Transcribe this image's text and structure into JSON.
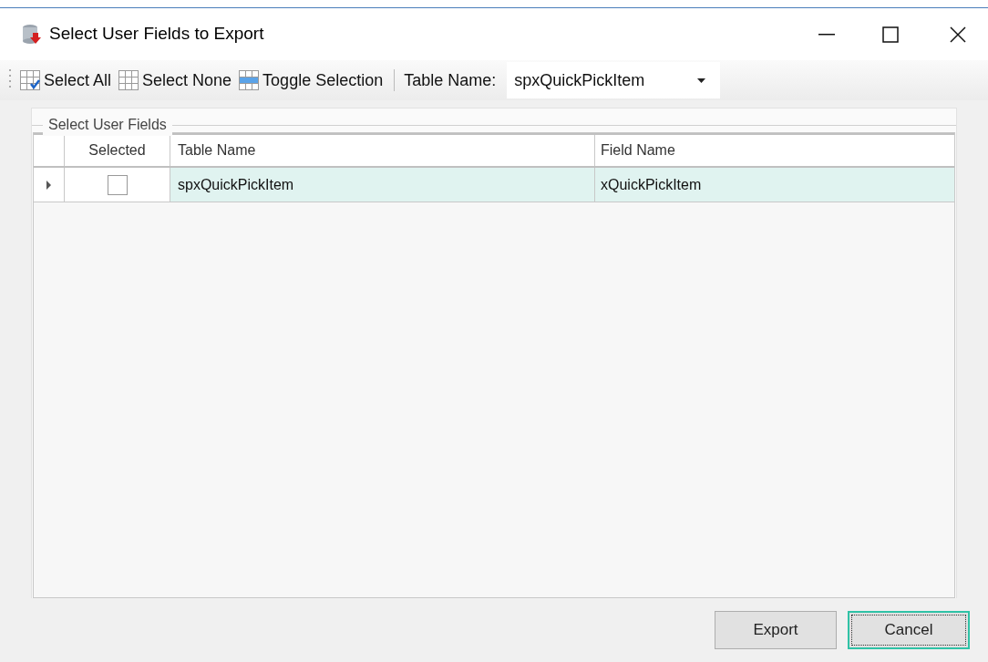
{
  "window": {
    "title": "Select User Fields to Export"
  },
  "toolbar": {
    "buttons": [
      {
        "kind": "all",
        "label": "Select All"
      },
      {
        "kind": "none",
        "label": "Select None"
      },
      {
        "kind": "toggle",
        "label": "Toggle Selection"
      }
    ],
    "table_name_label": "Table Name:",
    "table_name_value": "spxQuickPickItem"
  },
  "group": {
    "title": "Select User Fields"
  },
  "table": {
    "columns": [
      "Selected",
      "Table Name",
      "Field Name"
    ],
    "rows": [
      {
        "current": true,
        "checked": false,
        "selected": true,
        "table_name": "spxQuickPickItem",
        "field_name": "xQuickPickItem"
      }
    ]
  },
  "buttons": [
    {
      "label": "Export",
      "focused": false
    },
    {
      "label": "Cancel",
      "focused": true
    }
  ]
}
